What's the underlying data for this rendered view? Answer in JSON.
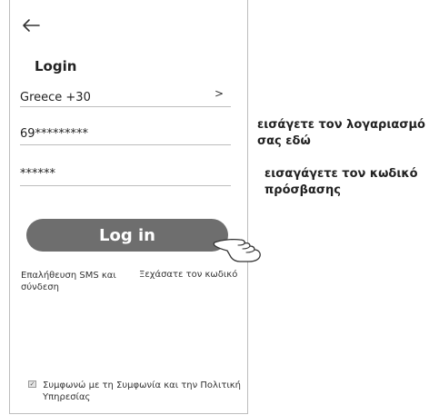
{
  "screen": {
    "title": "Login",
    "country_field": {
      "value": "Greece +30",
      "chevron": ">"
    },
    "account_field": {
      "value": "69*********"
    },
    "password_field": {
      "value": "******"
    },
    "login_button": "Log in",
    "sms_login": "Επαλήθευση SMS και σύνδεση",
    "forgot_password": "Ξεχάσατε τον κωδικό",
    "agreement": {
      "checked": true,
      "text": "Συμφωνώ με τη Συμφωνία και την Πολιτική Υπηρεσίας"
    }
  },
  "annotations": {
    "account_hint": "εισάγετε τον λογαριασμό σας εδώ",
    "password_hint": "εισαγάγετε τον κωδικό πρόσβασης"
  },
  "icons": {
    "back": "back-arrow-icon",
    "hand": "pointing-hand-icon",
    "checkbox": "checkbox-icon"
  },
  "colors": {
    "button": "#6e6e6e",
    "border": "#bdbdbd"
  }
}
